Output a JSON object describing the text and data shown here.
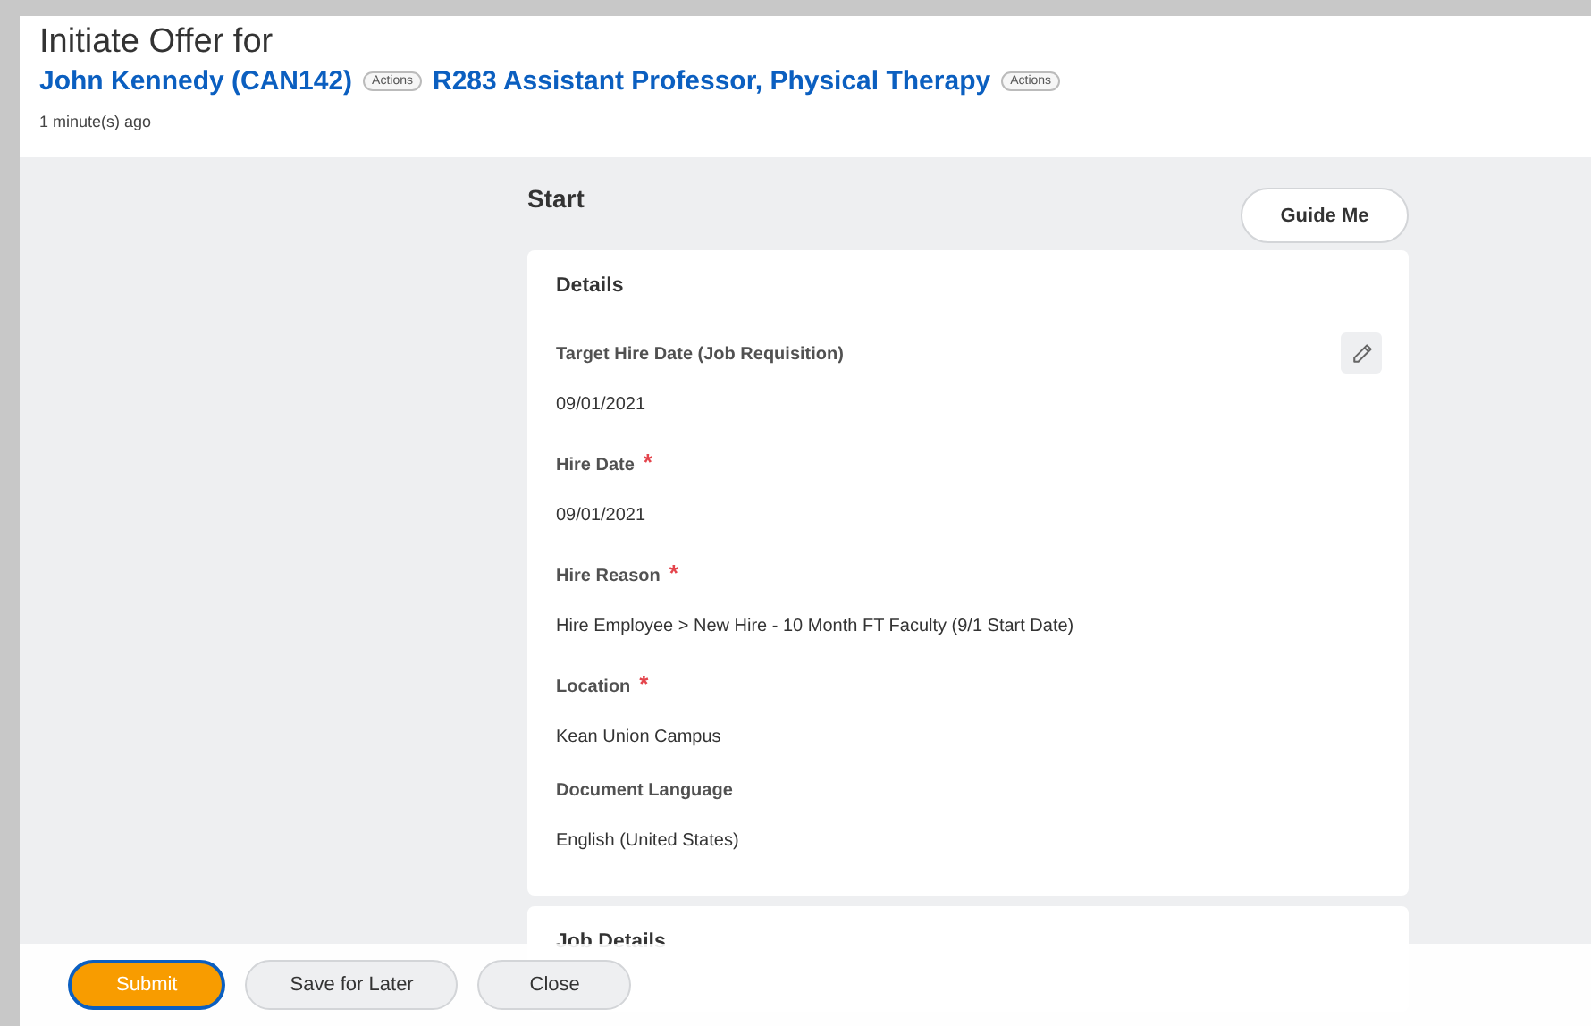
{
  "header": {
    "title": "Initiate Offer for",
    "candidate_link": "John Kennedy (CAN142)",
    "candidate_actions": "Actions",
    "job_link": "R283 Assistant Professor, Physical Therapy",
    "job_actions": "Actions",
    "timestamp": "1 minute(s) ago"
  },
  "step": {
    "title": "Start",
    "guide_button": "Guide Me"
  },
  "cards": [
    {
      "title": "Details",
      "editable": true,
      "fields": [
        {
          "label": "Target Hire Date (Job Requisition)",
          "value": "09/01/2021"
        },
        {
          "label": "Hire Date",
          "required_mark": "*",
          "value": "09/01/2021"
        },
        {
          "label": "Hire Reason",
          "required_mark": "*",
          "value": "Hire Employee > New Hire - 10 Month FT Faculty (9/1 Start Date)"
        },
        {
          "label": "Location",
          "required_mark": "*",
          "value": "Kean Union Campus"
        },
        {
          "label": "Document Language",
          "value": "English (United States)"
        }
      ]
    },
    {
      "title": "Job Details"
    }
  ],
  "footer": {
    "buttons": [
      {
        "label": "Submit",
        "kind": "primary"
      },
      {
        "label": "Save for Later",
        "kind": "secondary"
      },
      {
        "label": "Close",
        "kind": "secondary"
      }
    ]
  }
}
